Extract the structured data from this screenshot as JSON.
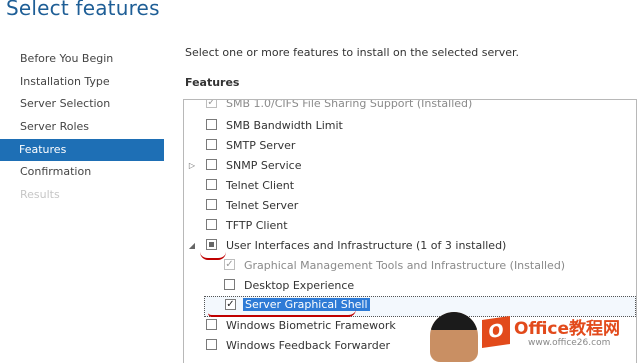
{
  "page": {
    "title": "Select features"
  },
  "nav": {
    "items": [
      {
        "label": "Before You Begin",
        "state": "normal"
      },
      {
        "label": "Installation Type",
        "state": "normal"
      },
      {
        "label": "Server Selection",
        "state": "normal"
      },
      {
        "label": "Server Roles",
        "state": "normal"
      },
      {
        "label": "Features",
        "state": "active"
      },
      {
        "label": "Confirmation",
        "state": "normal"
      },
      {
        "label": "Results",
        "state": "disabled"
      }
    ]
  },
  "main": {
    "instruction": "Select one or more features to install on the selected server.",
    "section_label": "Features",
    "features": [
      {
        "label": "SMB 1.0/CIFS File Sharing Support (Installed)",
        "checked": true,
        "grey": true
      },
      {
        "label": "SMB Bandwidth Limit",
        "checked": false
      },
      {
        "label": "SMTP Server",
        "checked": false
      },
      {
        "label": "SNMP Service",
        "checked": false,
        "expander": "collapsed"
      },
      {
        "label": "Telnet Client",
        "checked": false
      },
      {
        "label": "Telnet Server",
        "checked": false
      },
      {
        "label": "TFTP Client",
        "checked": false
      },
      {
        "label": "User Interfaces and Infrastructure (1 of 3 installed)",
        "checked": "partial",
        "expander": "expanded"
      },
      {
        "label": "Graphical Management Tools and Infrastructure (Installed)",
        "checked": true,
        "grey": true
      },
      {
        "label": "Desktop Experience",
        "checked": false
      },
      {
        "label": "Server Graphical Shell",
        "checked": true,
        "selected": true
      },
      {
        "label": "Windows Biometric Framework",
        "checked": false
      },
      {
        "label": "Windows Feedback Forwarder",
        "checked": false
      }
    ]
  },
  "watermark": {
    "logo_letter": "O",
    "name": "Office教程网",
    "url": "www.office26.com"
  }
}
